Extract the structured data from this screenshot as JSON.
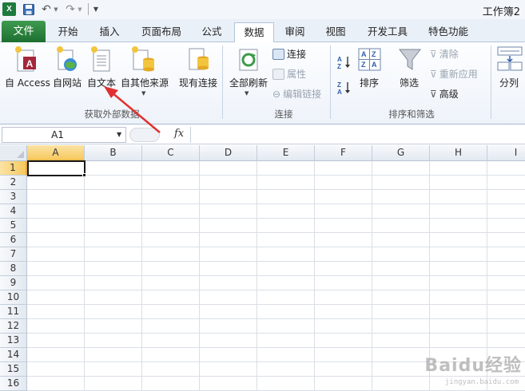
{
  "app": {
    "icon_letter": "X",
    "window_title": "工作簿2"
  },
  "tabs": [
    {
      "label": "文件",
      "active": false
    },
    {
      "label": "开始",
      "active": false
    },
    {
      "label": "插入",
      "active": false
    },
    {
      "label": "页面布局",
      "active": false
    },
    {
      "label": "公式",
      "active": false
    },
    {
      "label": "数据",
      "active": true
    },
    {
      "label": "审阅",
      "active": false
    },
    {
      "label": "视图",
      "active": false
    },
    {
      "label": "开发工具",
      "active": false
    },
    {
      "label": "特色功能",
      "active": false
    }
  ],
  "ribbon": {
    "get_external": {
      "group_label": "获取外部数据",
      "access": "自 Access",
      "web": "自网站",
      "text": "自文本",
      "other": "自其他来源",
      "existing": "现有连接"
    },
    "connections": {
      "group_label": "连接",
      "refresh_all": "全部刷新",
      "connections": "连接",
      "properties": "属性",
      "edit_links": "编辑链接"
    },
    "sort_filter": {
      "group_label": "排序和筛选",
      "sort": "排序",
      "filter": "筛选",
      "clear": "清除",
      "reapply": "重新应用",
      "advanced": "高级"
    },
    "tools": {
      "text_to_columns": "分列"
    }
  },
  "formula_bar": {
    "name_box": "A1",
    "fx": "fx",
    "formula": ""
  },
  "grid": {
    "columns": [
      "A",
      "B",
      "C",
      "D",
      "E",
      "F",
      "G",
      "H",
      "I"
    ],
    "rows": [
      "1",
      "2",
      "3",
      "4",
      "5",
      "6",
      "7",
      "8",
      "9",
      "10",
      "11",
      "12",
      "13",
      "14",
      "15",
      "16"
    ],
    "active_cell": "A1"
  },
  "colors": {
    "file_tab": "#1e6f31",
    "active_header": "#f6c95e",
    "annotation_arrow": "#e03131"
  },
  "watermark": {
    "text": "Baidu经验",
    "sub": "jingyan.baidu.com"
  }
}
